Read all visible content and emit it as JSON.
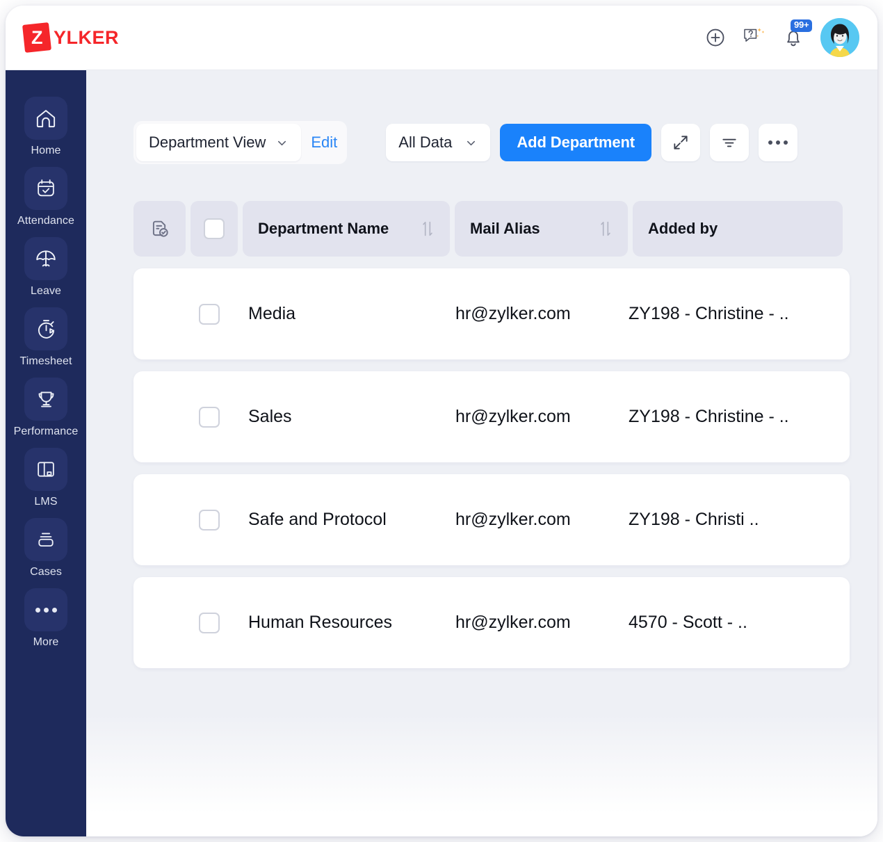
{
  "brand": {
    "mark_letter": "Z",
    "name": "YLKER"
  },
  "topbar": {
    "icons": [
      {
        "name": "add-circle-icon",
        "label": "Add"
      },
      {
        "name": "help-chat-icon",
        "label": "Help"
      },
      {
        "name": "notifications-bell-icon",
        "label": "Notifications"
      }
    ],
    "notification_badge": "99+",
    "avatar_label": "User profile"
  },
  "sidebar": {
    "items": [
      {
        "label": "Home",
        "icon": "home-icon"
      },
      {
        "label": "Attendance",
        "icon": "calendar-check-icon"
      },
      {
        "label": "Leave",
        "icon": "beach-umbrella-icon"
      },
      {
        "label": "Timesheet",
        "icon": "stopwatch-play-icon"
      },
      {
        "label": "Performance",
        "icon": "trophy-icon"
      },
      {
        "label": "LMS",
        "icon": "book-icon"
      },
      {
        "label": "Cases",
        "icon": "cases-box-icon"
      },
      {
        "label": "More",
        "icon": "ellipsis-icon"
      }
    ]
  },
  "toolbar": {
    "view_select": "Department View",
    "edit_link": "Edit",
    "data_select": "All Data",
    "add_button": "Add Department",
    "expand_icon": "expand-arrows-icon",
    "filter_icon": "filter-icon",
    "more_icon": "more-horizontal-icon"
  },
  "table": {
    "record_icon": "document-check-icon",
    "columns": [
      {
        "label": "Department Name",
        "sortable": true
      },
      {
        "label": "Mail Alias",
        "sortable": true
      },
      {
        "label": "Added by",
        "sortable": false
      }
    ],
    "rows": [
      {
        "department": "Media",
        "mail_alias": "hr@zylker.com",
        "added_by": "ZY198 - Christine - .."
      },
      {
        "department": "Sales",
        "mail_alias": "hr@zylker.com",
        "added_by": "ZY198 - Christine - .."
      },
      {
        "department": "Safe and Protocol",
        "mail_alias": "hr@zylker.com",
        "added_by": "ZY198 - Christi .."
      },
      {
        "department": "Human Resources",
        "mail_alias": "hr@zylker.com",
        "added_by": "4570 - Scott - .."
      }
    ]
  },
  "colors": {
    "sidebar": "#1e2a5c",
    "primary": "#1a82fb",
    "brand_red": "#f5262a",
    "header_cell": "#e2e3ee",
    "canvas": "#eef0f5"
  }
}
